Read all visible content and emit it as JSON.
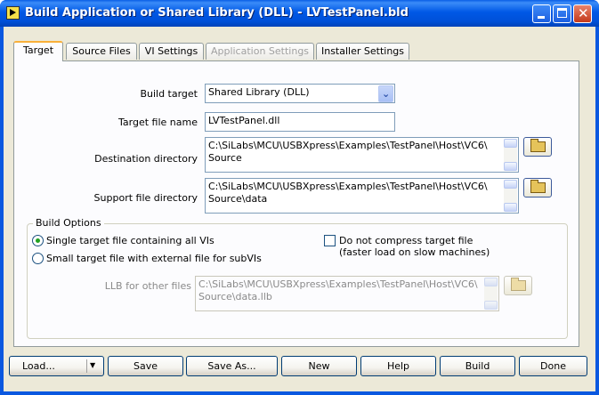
{
  "window": {
    "title": "Build Application or Shared Library (DLL) - LVTestPanel.bld"
  },
  "tabs": [
    {
      "label": "Target",
      "state": "active"
    },
    {
      "label": "Source Files",
      "state": "normal"
    },
    {
      "label": "VI Settings",
      "state": "normal"
    },
    {
      "label": "Application Settings",
      "state": "disabled"
    },
    {
      "label": "Installer Settings",
      "state": "normal"
    }
  ],
  "target": {
    "build_target_label": "Build target",
    "build_target_value": "Shared Library (DLL)",
    "target_file_name_label": "Target file name",
    "target_file_name_value": "LVTestPanel.dll",
    "destination_directory_label": "Destination directory",
    "destination_directory_line1": "C:\\SiLabs\\MCU\\USBXpress\\Examples\\TestPanel\\Host\\VC6\\",
    "destination_directory_line2": "Source",
    "support_file_directory_label": "Support file directory",
    "support_file_directory_line1": "C:\\SiLabs\\MCU\\USBXpress\\Examples\\TestPanel\\Host\\VC6\\",
    "support_file_directory_line2": "Source\\data"
  },
  "build_options": {
    "group_title": "Build Options",
    "single_target_label": "Single target file containing all VIs",
    "single_target_selected": true,
    "small_target_label": "Small target file with external file for subVIs",
    "small_target_selected": false,
    "no_compress_label_line1": "Do not compress target file",
    "no_compress_label_line2": "(faster load on slow machines)",
    "no_compress_checked": false,
    "llb_label": "LLB for other files",
    "llb_value_line1": "C:\\SiLabs\\MCU\\USBXpress\\Examples\\TestPanel\\Host\\VC6\\",
    "llb_value_line2": "Source\\data.llb"
  },
  "buttons": {
    "load": "Load...",
    "save": "Save",
    "save_as": "Save As...",
    "new": "New",
    "help": "Help",
    "build": "Build",
    "done": "Done"
  },
  "colors": {
    "titlebar": "#0058e6",
    "tab_highlight": "#f9b03a",
    "radio_selected": "#21a121"
  }
}
